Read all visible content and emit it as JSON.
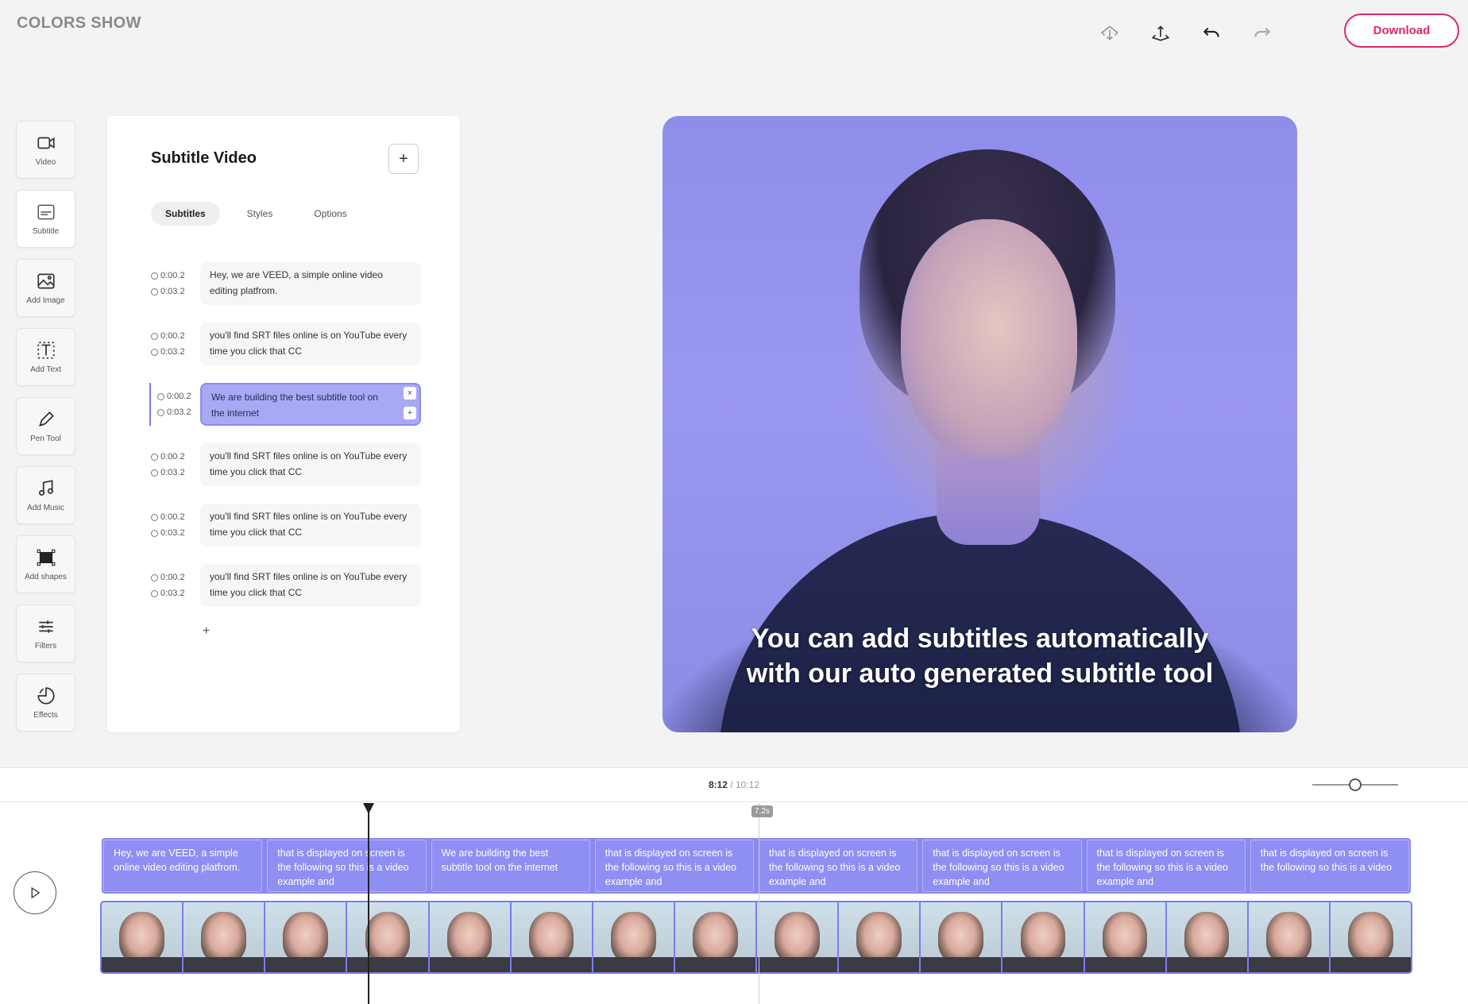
{
  "app": {
    "title": "COLORS SHOW"
  },
  "toolbar": {
    "download_label": "Download",
    "icons": [
      "cloud-download-icon",
      "cloud-upload-icon",
      "undo-icon",
      "redo-icon"
    ]
  },
  "sidebar": {
    "items": [
      {
        "label": "Video",
        "icon": "video-camera-icon"
      },
      {
        "label": "Subtitle",
        "icon": "subtitle-icon"
      },
      {
        "label": "Add Image",
        "icon": "image-icon"
      },
      {
        "label": "Add Text",
        "icon": "text-icon"
      },
      {
        "label": "Pen Tool",
        "icon": "pen-icon"
      },
      {
        "label": "Add Music",
        "icon": "music-note-icon"
      },
      {
        "label": "Add shapes",
        "icon": "shapes-icon"
      },
      {
        "label": "Filters",
        "icon": "sliders-icon"
      },
      {
        "label": "Effects",
        "icon": "effects-icon"
      }
    ],
    "active_index": 1
  },
  "panel": {
    "title": "Subtitle Video",
    "add_label": "+",
    "tabs": [
      {
        "label": "Subtitles",
        "active": true
      },
      {
        "label": "Styles",
        "active": false
      },
      {
        "label": "Options",
        "active": false
      }
    ],
    "subtitles": [
      {
        "start": "0:00.2",
        "end": "0:03.2",
        "text": "Hey, we are VEED, a simple online video editing platfrom.",
        "active": false
      },
      {
        "start": "0:00.2",
        "end": "0:03.2",
        "text": "you'll find SRT files online is on YouTube every time you click that CC",
        "active": false
      },
      {
        "start": "0:00.2",
        "end": "0:03.2",
        "text": "We are building the best subtitle tool on the internet",
        "active": true
      },
      {
        "start": "0:00.2",
        "end": "0:03.2",
        "text": "you'll find SRT files online is on YouTube every time you click that CC",
        "active": false
      },
      {
        "start": "0:00.2",
        "end": "0:03.2",
        "text": "you'll find SRT files online is on YouTube every time you click that CC",
        "active": false
      },
      {
        "start": "0:00.2",
        "end": "0:03.2",
        "text": "you'll find SRT files online is on YouTube every time you click that CC",
        "active": false
      }
    ],
    "row_remove_label": "×",
    "row_add_label": "+",
    "list_add_label": "+"
  },
  "preview": {
    "caption_line1": "You can add subtitles automatically",
    "caption_line2": "with our auto generated subtitle tool"
  },
  "timeline": {
    "current_time": "8:12",
    "separator": " / ",
    "total_time": "10:12",
    "marker_label": "7.2s",
    "zoom_level": 0.5,
    "clips": [
      "Hey, we are VEED, a simple online video editing platfrom.",
      "that is displayed on screen is the following so this is a video example and",
      "We are building the best subtitle tool on the internet",
      "that is displayed on screen is the following so this is a video example and",
      "that is displayed on screen is the following so this is a video example and",
      "that is displayed on screen is the following so this is a video example and",
      "that is displayed on screen is the following so this is a video example and",
      "that is displayed on screen is the following so this is a video"
    ],
    "thumbnail_count": 16
  }
}
